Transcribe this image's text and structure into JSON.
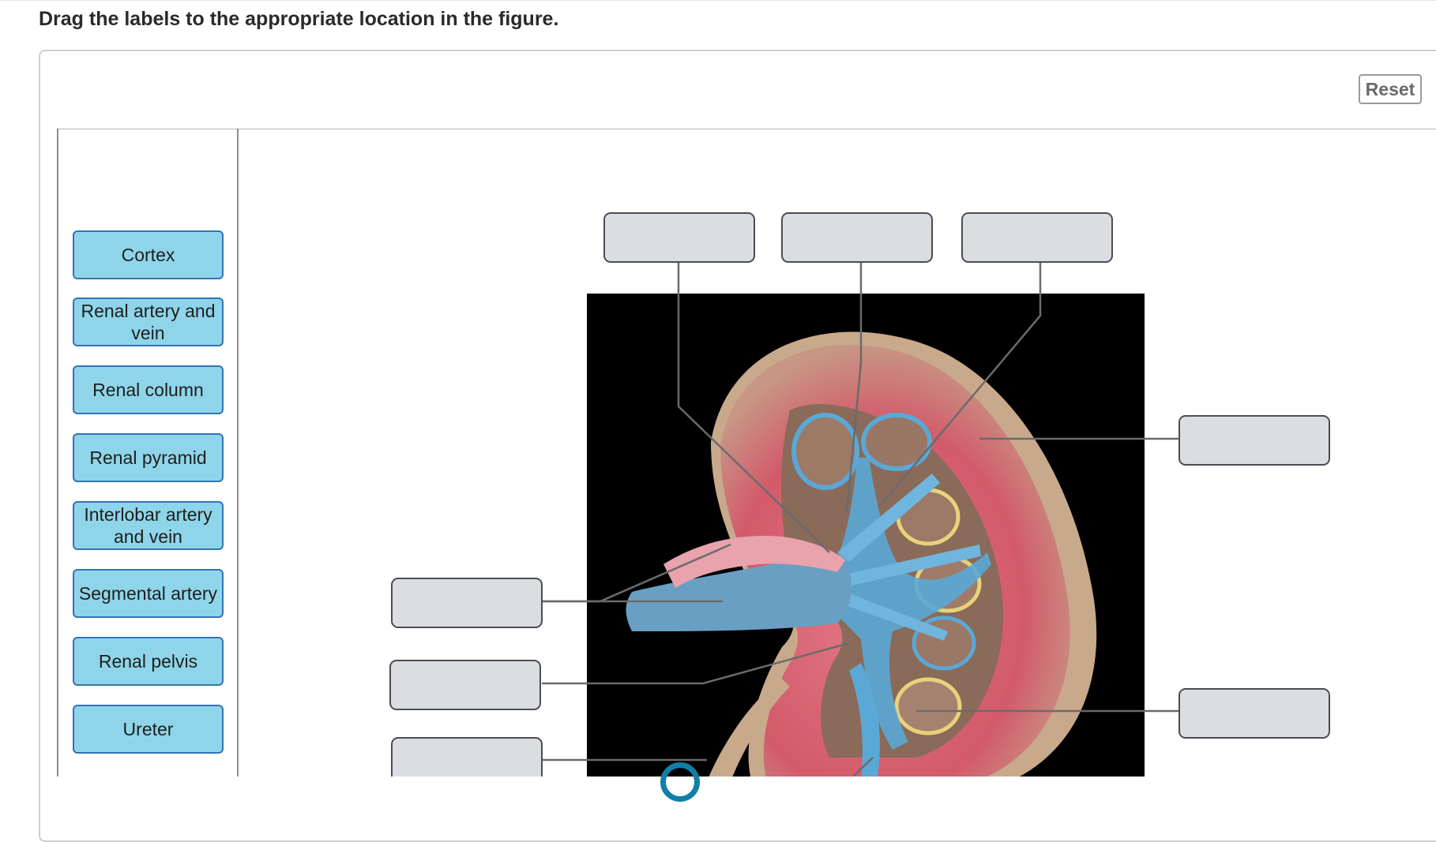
{
  "instructions": "Drag the labels to the appropriate location in the figure.",
  "reset_label": "Reset",
  "labels": [
    "Cortex",
    "Renal artery and vein",
    "Renal column",
    "Renal pyramid",
    "Interlobar artery and vein",
    "Segmental artery",
    "Renal pelvis",
    "Ureter"
  ],
  "drop_target_count": 8,
  "colors": {
    "label_fill": "#8fd5e9",
    "label_border": "#3174b6",
    "target_fill": "#dcdde0",
    "target_border": "#4a4d55",
    "figure_background": "#000000",
    "cortex": "#d65c6b",
    "medulla": "#8a5a4a",
    "vessels": "#5aa8d6"
  }
}
